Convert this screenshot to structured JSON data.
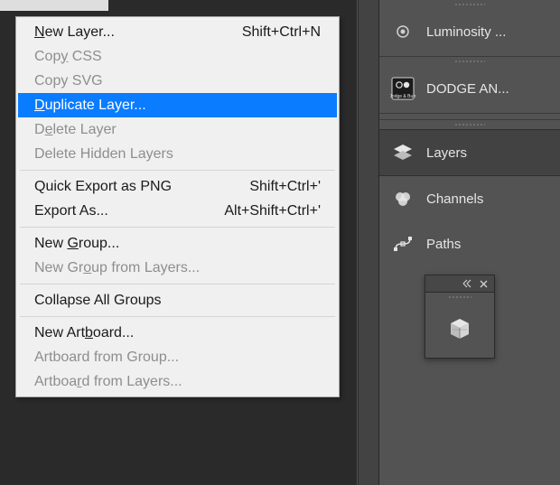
{
  "context_menu": {
    "items": [
      {
        "label_pre": "",
        "label_u": "N",
        "label_post": "ew Layer...",
        "shortcut": "Shift+Ctrl+N",
        "state": "normal"
      },
      {
        "label_pre": "Cop",
        "label_u": "y",
        "label_post": " CSS",
        "shortcut": "",
        "state": "disabled"
      },
      {
        "label_pre": "Copy SVG",
        "label_u": "",
        "label_post": "",
        "shortcut": "",
        "state": "disabled"
      },
      {
        "label_pre": "",
        "label_u": "D",
        "label_post": "uplicate Layer...",
        "shortcut": "",
        "state": "highlight"
      },
      {
        "label_pre": "D",
        "label_u": "e",
        "label_post": "lete Layer",
        "shortcut": "",
        "state": "disabled"
      },
      {
        "label_pre": "Delete Hidden Layers",
        "label_u": "",
        "label_post": "",
        "shortcut": "",
        "state": "disabled"
      },
      {
        "sep": true
      },
      {
        "label_pre": "Quick Export as PNG",
        "label_u": "",
        "label_post": "",
        "shortcut": "Shift+Ctrl+'",
        "state": "normal"
      },
      {
        "label_pre": "Export As...",
        "label_u": "",
        "label_post": "",
        "shortcut": "Alt+Shift+Ctrl+'",
        "state": "normal"
      },
      {
        "sep": true
      },
      {
        "label_pre": "New ",
        "label_u": "G",
        "label_post": "roup...",
        "shortcut": "",
        "state": "normal"
      },
      {
        "label_pre": "New Gr",
        "label_u": "o",
        "label_post": "up from Layers...",
        "shortcut": "",
        "state": "disabled"
      },
      {
        "sep": true
      },
      {
        "label_pre": "Collapse All Groups",
        "label_u": "",
        "label_post": "",
        "shortcut": "",
        "state": "normal"
      },
      {
        "sep": true
      },
      {
        "label_pre": "New Art",
        "label_u": "b",
        "label_post": "oard...",
        "shortcut": "",
        "state": "normal"
      },
      {
        "label_pre": "Artboard from Group...",
        "label_u": "",
        "label_post": "",
        "shortcut": "",
        "state": "disabled"
      },
      {
        "label_pre": "Artboa",
        "label_u": "r",
        "label_post": "d from Layers...",
        "shortcut": "",
        "state": "disabled"
      }
    ]
  },
  "right_panel": {
    "group1": [
      {
        "label": "Luminosity ..."
      }
    ],
    "group2": [
      {
        "label": "DODGE AN..."
      }
    ],
    "tabs": [
      {
        "label": "Layers",
        "active": true
      },
      {
        "label": "Channels",
        "active": false
      },
      {
        "label": "Paths",
        "active": false
      }
    ]
  }
}
